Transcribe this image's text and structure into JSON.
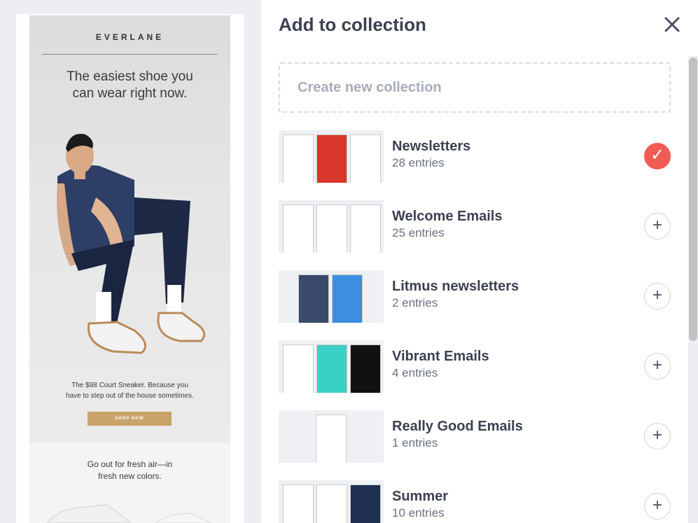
{
  "preview": {
    "brand": "EVERLANE",
    "headline_line1": "The easiest shoe you",
    "headline_line2": "can wear right now.",
    "caption_line1": "The $98 Court Sneaker. Because you",
    "caption_line2": "have to step out of the house sometimes.",
    "cta": "SHOP NOW",
    "second_line1": "Go out for fresh air—in",
    "second_line2": "fresh new colors."
  },
  "panel": {
    "title": "Add to collection",
    "close_icon": "close-icon",
    "create_label": "Create new collection"
  },
  "collections": [
    {
      "name": "Newsletters",
      "count": "28 entries",
      "selected": true,
      "thumb_colors": [
        "#ffffff",
        "#d9362b",
        "#ffffff"
      ]
    },
    {
      "name": "Welcome Emails",
      "count": "25 entries",
      "selected": false,
      "thumb_colors": [
        "#ffffff",
        "#ffffff",
        "#ffffff"
      ]
    },
    {
      "name": "Litmus newsletters",
      "count": "2 entries",
      "selected": false,
      "thumb_colors": [
        "#3a4a6b",
        "#3d8ee0"
      ]
    },
    {
      "name": "Vibrant Emails",
      "count": "4 entries",
      "selected": false,
      "thumb_colors": [
        "#ffffff",
        "#3ad1c4",
        "#111111"
      ]
    },
    {
      "name": "Really Good Emails",
      "count": "1 entries",
      "selected": false,
      "thumb_colors": [
        "#ffffff"
      ]
    },
    {
      "name": "Summer",
      "count": "10 entries",
      "selected": false,
      "thumb_colors": [
        "#ffffff",
        "#ffffff",
        "#1f3050"
      ]
    }
  ],
  "icons": {
    "check": "check-icon",
    "plus": "plus-icon"
  },
  "colors": {
    "accent": "#f25c54",
    "text": "#3c4150",
    "muted": "#6a7080"
  }
}
